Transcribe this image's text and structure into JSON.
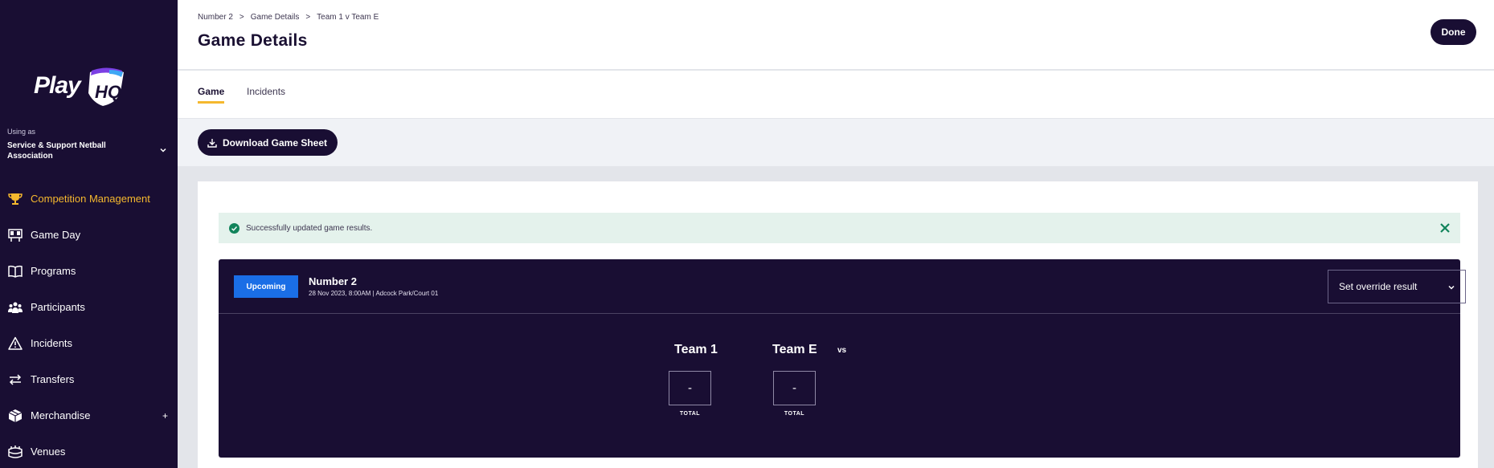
{
  "sidebar": {
    "logo_text": "Play",
    "logo_hq": "HQ",
    "org_caption": "Using as",
    "org_name": "Service & Support Netball Association",
    "items": [
      {
        "label": "Competition Management",
        "icon": "trophy-icon",
        "active": true
      },
      {
        "label": "Game Day",
        "icon": "scoreboard-icon"
      },
      {
        "label": "Programs",
        "icon": "book-icon"
      },
      {
        "label": "Participants",
        "icon": "people-icon"
      },
      {
        "label": "Incidents",
        "icon": "warning-icon"
      },
      {
        "label": "Transfers",
        "icon": "transfer-arrows-icon"
      },
      {
        "label": "Merchandise",
        "icon": "box-icon",
        "expand": "+"
      },
      {
        "label": "Venues",
        "icon": "stadium-icon"
      }
    ]
  },
  "header": {
    "breadcrumb": [
      "Number 2",
      "Game Details",
      "Team 1 v Team E"
    ],
    "separator": ">",
    "title": "Game Details",
    "done_label": "Done"
  },
  "tabs": [
    {
      "label": "Game",
      "active": true
    },
    {
      "label": "Incidents",
      "active": false
    }
  ],
  "toolbar": {
    "download_label": "Download Game Sheet"
  },
  "alert": {
    "message": "Successfully updated game results."
  },
  "game": {
    "status": "Upcoming",
    "round": "Number 2",
    "meta": "28 Nov 2023, 8:00AM | Adcock Park/Court 01",
    "override_label": "Set override result",
    "home_team": "Team 1",
    "away_team": "Team E",
    "vs": "vs",
    "home_score": "-",
    "away_score": "-",
    "total_label": "TOTAL"
  },
  "colors": {
    "sidebar_bg": "#190e33",
    "accent": "#f5b82e",
    "badge_blue": "#1a6ee6",
    "alert_green": "#e4f2ec",
    "success_green": "#11845b"
  }
}
